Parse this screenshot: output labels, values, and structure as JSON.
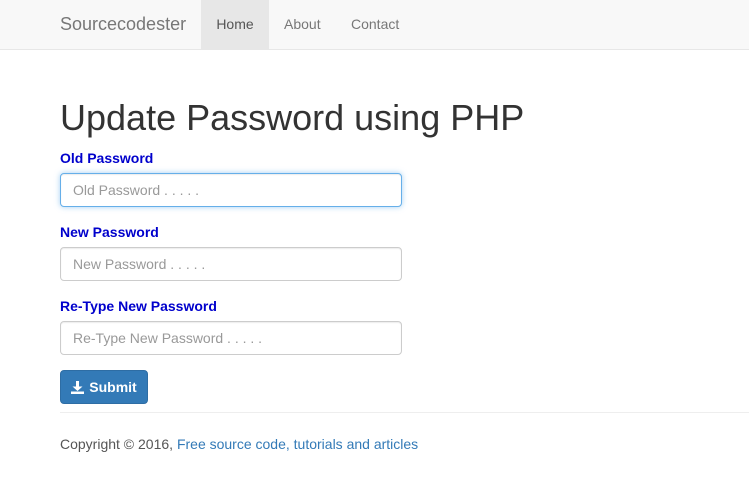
{
  "navbar": {
    "brand": "Sourcecodester",
    "links": [
      {
        "label": "Home",
        "active": true
      },
      {
        "label": "About",
        "active": false
      },
      {
        "label": "Contact",
        "active": false
      }
    ]
  },
  "page": {
    "title": "Update Password using PHP"
  },
  "form": {
    "old_password": {
      "label": "Old Password",
      "placeholder": "Old Password . . . . .",
      "value": ""
    },
    "new_password": {
      "label": "New Password",
      "placeholder": "New Password . . . . .",
      "value": ""
    },
    "retype_password": {
      "label": "Re-Type New Password",
      "placeholder": "Re-Type New Password . . . . .",
      "value": ""
    },
    "submit_label": "Submit",
    "submit_icon": "download-icon"
  },
  "footer": {
    "copyright": "Copyright © 2016,",
    "link_text": "Free source code, tutorials and articles"
  },
  "colors": {
    "navbar_bg": "#f8f8f8",
    "label": "#0000cc",
    "primary": "#337ab7",
    "focus_border": "#66afe9"
  }
}
